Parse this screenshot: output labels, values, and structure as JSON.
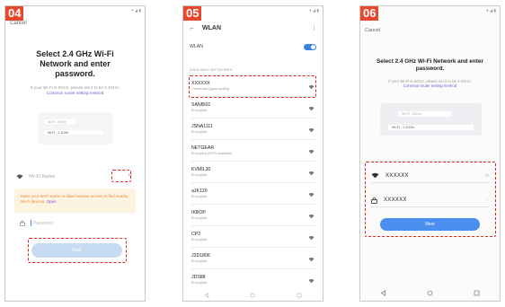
{
  "accent": "#e8482d",
  "screen1": {
    "badge": "04",
    "cancel": "Cancel",
    "title": "Select 2.4 GHz Wi-Fi Network and enter password.",
    "desc": "If your Wi-Fi is 5GHz, please set it to be 2.4GHz.",
    "desc_link": "Common router setting method",
    "router_bar1": "Wi-Fi - 5GHz",
    "router_bar2": "Wi-Fi - 2.4GHz",
    "wifi_placeholder": "Wi-Fi Name",
    "switch_link": "⇄",
    "warning": "Enter your Wi-Fi name or allow location access to find nearby Wi-Fi devices.",
    "warning_link": "Open",
    "password_placeholder": "Password",
    "next": "Next"
  },
  "screen2": {
    "badge": "05",
    "title": "WLAN",
    "wlan_label": "WLAN",
    "section": "AVAILABLE NETWORKS",
    "networks": [
      {
        "name": "XXXXXX",
        "status": "Connected (good quality)"
      },
      {
        "name": "SANBI01",
        "status": "Encrypted"
      },
      {
        "name": "JSNA1111",
        "status": "Encrypted"
      },
      {
        "name": "NETGEAR",
        "status": "Encrypted (WPS available)"
      },
      {
        "name": "KVMIL30",
        "status": "Encrypted"
      },
      {
        "name": "aJK120",
        "status": "Encrypted"
      },
      {
        "name": "IKBOP",
        "status": "Encrypted"
      },
      {
        "name": "CP2",
        "status": "Encrypted"
      },
      {
        "name": "J2D1806",
        "status": "Encrypted"
      },
      {
        "name": "JDS88",
        "status": "Encrypted"
      }
    ]
  },
  "screen3": {
    "badge": "06",
    "cancel": "Cancel",
    "title": "Select 2.4 GHz Wi-Fi Network and enter password.",
    "desc": "If your Wi-Fi is 5GHz, please set it to be 2.4GHz.",
    "desc_link": "Common router setting method",
    "router_bar1": "Wi-Fi - 5GHz",
    "router_bar2": "Wi-Fi - 2.4GHz",
    "wifi_value": "XXXXXX",
    "password_value": "XXXXXX",
    "next": "Next"
  }
}
